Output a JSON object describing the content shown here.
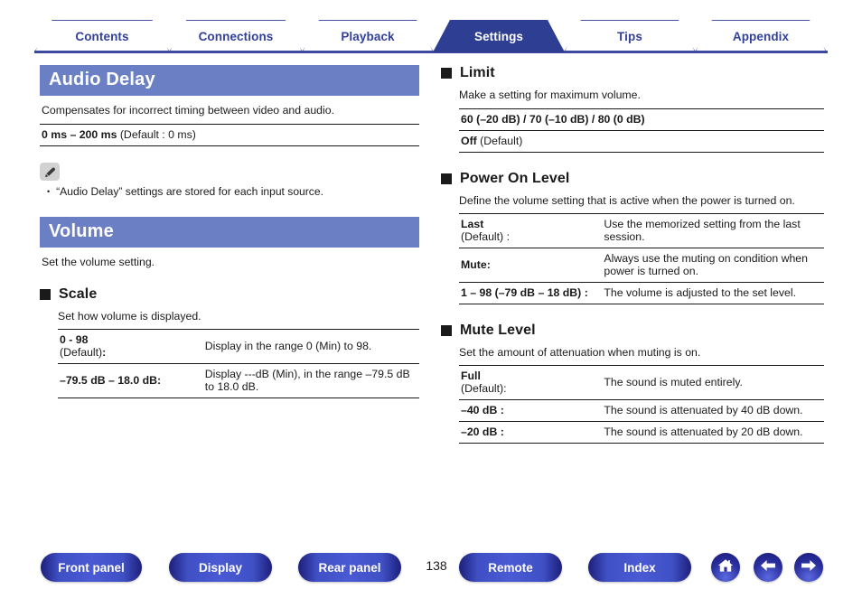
{
  "nav": {
    "tabs": [
      {
        "label": "Contents",
        "active": false
      },
      {
        "label": "Connections",
        "active": false
      },
      {
        "label": "Playback",
        "active": false
      },
      {
        "label": "Settings",
        "active": true
      },
      {
        "label": "Tips",
        "active": false
      },
      {
        "label": "Appendix",
        "active": false
      }
    ]
  },
  "left": {
    "audio_delay": {
      "title": "Audio Delay",
      "lead": "Compensates for incorrect timing between video and audio.",
      "rows": [
        {
          "bold": "0 ms – 200 ms",
          "rest": " (Default : 0 ms)"
        }
      ],
      "note": {
        "icon": "pencil-icon",
        "bullet": "•",
        "text": "“Audio Delay” settings are stored for each input source."
      }
    },
    "volume": {
      "title": "Volume",
      "lead": "Set the volume setting.",
      "scale": {
        "heading": "Scale",
        "desc": "Set how volume is displayed.",
        "rows": [
          {
            "term_bold": "0 - 98",
            "term_rest": "(Default)",
            "term_colon": ":",
            "desc": "Display in the range 0 (Min) to 98."
          },
          {
            "term_bold": "–79.5 dB – 18.0 dB:",
            "term_rest": "",
            "term_colon": "",
            "desc": "Display ---dB (Min), in the range –79.5 dB to 18.0 dB."
          }
        ]
      }
    }
  },
  "right": {
    "limit": {
      "heading": "Limit",
      "desc": "Make a setting for maximum volume.",
      "rows": [
        {
          "bold": "60 (–20 dB) / 70 (–10 dB) / 80 (0 dB)",
          "rest": ""
        },
        {
          "bold": "Off",
          "rest": " (Default)"
        }
      ]
    },
    "power_on_level": {
      "heading": "Power On Level",
      "desc": "Define the volume setting that is active when the power is turned on.",
      "rows": [
        {
          "term_bold": "Last",
          "term_rest": "(Default) :",
          "desc": "Use the memorized setting from the last session."
        },
        {
          "term_bold": "Mute:",
          "term_rest": "",
          "desc": "Always use the muting on condition when power is turned on."
        },
        {
          "term_bold": "1 – 98 (–79 dB – 18 dB) :",
          "term_rest": "",
          "desc": "The volume is adjusted to the set level."
        }
      ]
    },
    "mute_level": {
      "heading": "Mute Level",
      "desc": "Set the amount of attenuation when muting is on.",
      "rows": [
        {
          "term_bold": "Full",
          "term_rest": "(Default):",
          "desc": "The sound is muted entirely."
        },
        {
          "term_bold": "–40 dB :",
          "term_rest": "",
          "desc": "The sound is attenuated by 40 dB down."
        },
        {
          "term_bold": "–20 dB :",
          "term_rest": "",
          "desc": "The sound is attenuated by 20 dB down."
        }
      ]
    }
  },
  "footer": {
    "buttons": [
      {
        "label": "Front panel"
      },
      {
        "label": "Display"
      },
      {
        "label": "Rear panel"
      },
      {
        "label": "Remote"
      },
      {
        "label": "Index"
      }
    ],
    "page_number": "138",
    "icons": [
      {
        "name": "home-icon"
      },
      {
        "name": "arrow-left-icon"
      },
      {
        "name": "arrow-right-icon"
      }
    ]
  },
  "colors": {
    "tab_active_bg": "#2e3f93",
    "tab_text": "#33419a",
    "banner_bg": "#6b80c4",
    "rule": "#1a1a1a"
  }
}
